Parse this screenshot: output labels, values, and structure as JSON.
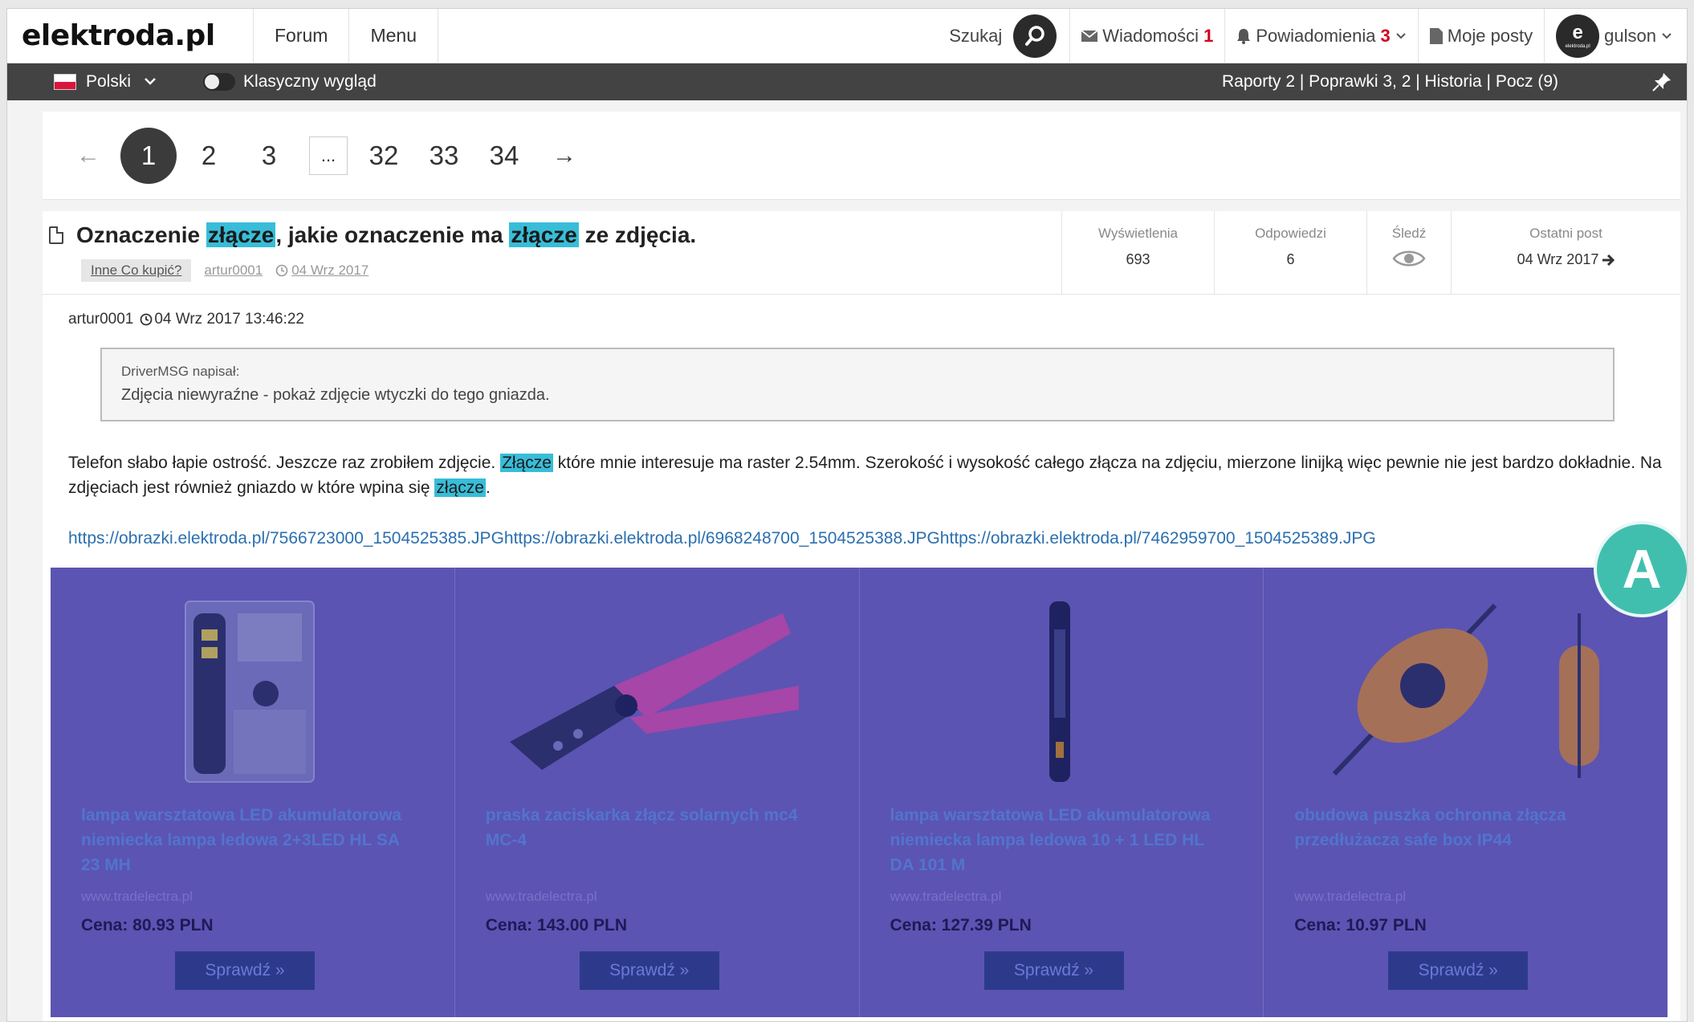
{
  "header": {
    "logo": "elektroda.pl",
    "nav": [
      "Forum",
      "Menu"
    ],
    "search_label": "Szukaj",
    "messages_label": "Wiadomości",
    "messages_count": "1",
    "notifications_label": "Powiadomienia",
    "notifications_count": "3",
    "my_posts_label": "Moje posty",
    "username": "gulson",
    "avatar_letter": "e",
    "avatar_text": "elektroda.pl"
  },
  "subbar": {
    "language": "Polski",
    "classic_view_label": "Klasyczny wygląd",
    "mod_links": "Raporty 2 | Poprawki 3, 2 | Historia | Pocz (9)"
  },
  "pagination": {
    "pages": [
      "1",
      "2",
      "3",
      "...",
      "32",
      "33",
      "34"
    ],
    "current": "1",
    "prev_arrow": "←",
    "next_arrow": "→"
  },
  "topic": {
    "title_parts": [
      "Oznaczenie ",
      "złącze",
      ", jakie oznaczenie ma ",
      "złącze",
      " ze zdjęcia."
    ],
    "tag": "Inne Co kupić?",
    "author": "artur0001",
    "date": "04 Wrz 2017",
    "stats": {
      "views_label": "Wyświetlenia",
      "views": "693",
      "replies_label": "Odpowiedzi",
      "replies": "6",
      "follow_label": "Śledź",
      "last_post_label": "Ostatni post",
      "last_post": "04 Wrz 2017"
    }
  },
  "post": {
    "author": "artur0001",
    "datetime": "04 Wrz 2017 13:46:22",
    "quote_author": "DriverMSG napisał:",
    "quote_text": "Zdjęcia niewyraźne - pokaż zdjęcie wtyczki do tego gniazda.",
    "text_1": "Telefon słabo łapie ostrość. Jeszcze raz zrobiłem zdjęcie. ",
    "hl_1": "Złącze",
    "text_2": " które mnie interesuje ma raster 2.54mm. Szerokość i wysokość całego złącza na zdjęciu, mierzone linijką więc pewnie nie jest bardzo dokładnie. Na zdjęciach jest również gniazdo w które wpina się ",
    "hl_2": "złącze",
    "text_3": ".",
    "links": "https://obrazki.elektroda.pl/7566723000_1504525385.JPGhttps://obrazki.elektroda.pl/6968248700_1504525388.JPGhttps://obrazki.elektroda.pl/7462959700_1504525389.JPG"
  },
  "ads": [
    {
      "title": "lampa warsztatowa LED akumulatorowa niemiecka lampa ledowa 2+3LED HL SA 23 MH",
      "site": "www.tradelectra.pl",
      "price": "Cena: 80.93 PLN",
      "button": "Sprawdź »",
      "icon": "lamp-package-image"
    },
    {
      "title": "praska zaciskarka złącz solarnych mc4 MC-4",
      "site": "www.tradelectra.pl",
      "price": "Cena: 143.00 PLN",
      "button": "Sprawdź »",
      "icon": "crimper-image"
    },
    {
      "title": "lampa warsztatowa LED akumulatorowa niemiecka lampa ledowa 10 + 1 LED HL DA 101 M",
      "site": "www.tradelectra.pl",
      "price": "Cena: 127.39 PLN",
      "button": "Sprawdź »",
      "icon": "led-stick-image"
    },
    {
      "title": "obudowa puszka ochronna złącza przedłużacza safe box IP44",
      "site": "www.tradelectra.pl",
      "price": "Cena: 10.97 PLN",
      "button": "Sprawdź »",
      "icon": "safe-box-image"
    }
  ],
  "overlay_badge": "A",
  "colors": {
    "highlight": "#38bdd8",
    "subbar_bg": "#434343",
    "ad_overlay": "#5b54b3",
    "badge": "#41bfae",
    "alert_red": "#d0021b"
  }
}
